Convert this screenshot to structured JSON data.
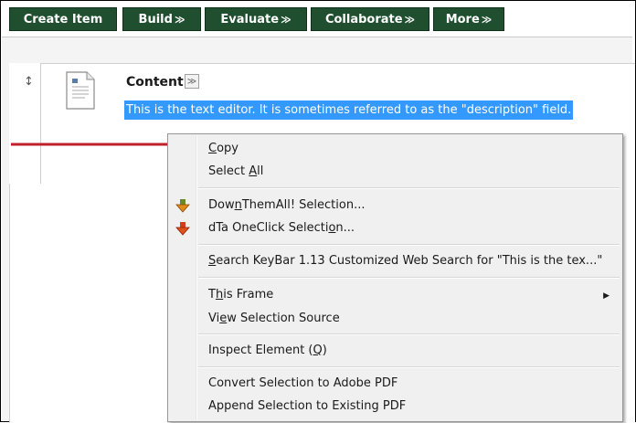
{
  "toolbar": {
    "buttons": [
      {
        "label": "Create Item",
        "has_menu": false
      },
      {
        "label": "Build",
        "has_menu": true
      },
      {
        "label": "Evaluate",
        "has_menu": true
      },
      {
        "label": "Collaborate",
        "has_menu": true
      },
      {
        "label": "More",
        "has_menu": true
      }
    ],
    "menu_chevron": "≫",
    "bg_color": "#1f4f2f"
  },
  "content_item": {
    "drag_handle": "↕",
    "title": "Content",
    "title_chevron": "≫",
    "description": "This is the text editor. It is sometimes referred to as the \"description\" field."
  },
  "context_menu": {
    "items": [
      {
        "label": "Copy",
        "accel": "C",
        "icon": null
      },
      {
        "label": "Select All",
        "accel": "A",
        "icon": null
      },
      {
        "label": "DownThemAll! Selection...",
        "accel": "n",
        "icon": "downthemall-icon"
      },
      {
        "label": "dTa OneClick Selection...",
        "accel": "o",
        "icon": "dta-oneclick-icon"
      },
      {
        "label": "Search KeyBar 1.13 Customized Web Search for \"This is the tex...\"",
        "accel": "S",
        "icon": null
      },
      {
        "label": "This Frame",
        "accel": "h",
        "icon": null,
        "submenu": true
      },
      {
        "label": "View Selection Source",
        "accel": "e",
        "icon": null
      },
      {
        "label": "Inspect Element (Q)",
        "accel": "Q",
        "icon": null
      },
      {
        "label": "Convert Selection to Adobe PDF",
        "accel": null,
        "icon": null
      },
      {
        "label": "Append Selection to Existing PDF",
        "accel": null,
        "icon": null
      }
    ]
  },
  "colors": {
    "selection": "#3399ff",
    "arrow": "#c0202a",
    "menu_bg": "#f0f0f0"
  }
}
